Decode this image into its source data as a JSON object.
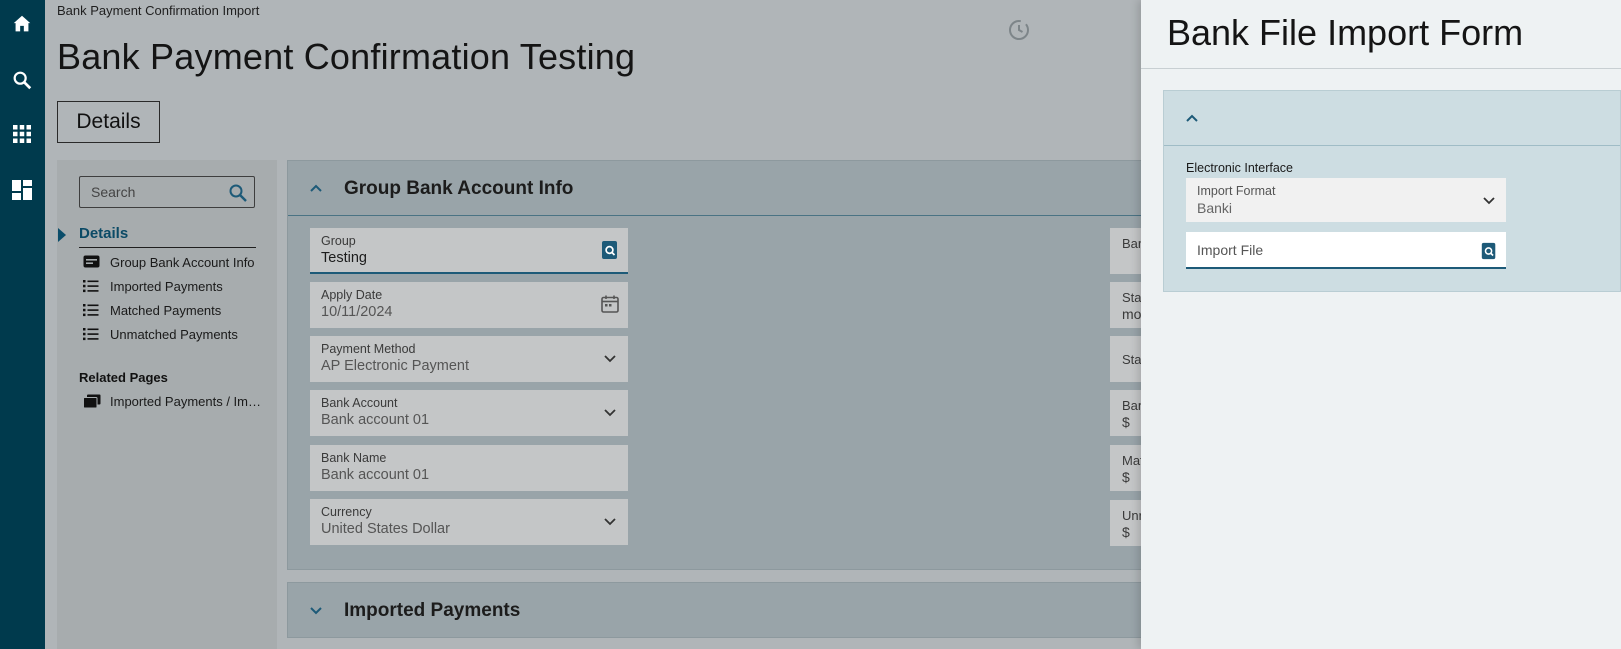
{
  "rail": {
    "items": [
      "home-icon",
      "search-icon",
      "apps-grid-icon",
      "dashboard-icon"
    ]
  },
  "header": {
    "breadcrumb": "Bank Payment Confirmation Import",
    "title": "Bank Payment Confirmation Testing",
    "tab_label": "Details"
  },
  "sidenav": {
    "search_placeholder": "Search",
    "details_label": "Details",
    "items": [
      {
        "label": "Group Bank Account Info",
        "icon": "card-icon"
      },
      {
        "label": "Imported Payments",
        "icon": "list-icon"
      },
      {
        "label": "Matched Payments",
        "icon": "list-icon"
      },
      {
        "label": "Unmatched Payments",
        "icon": "list-icon"
      }
    ],
    "related_title": "Related Pages",
    "related_items": [
      {
        "label": "Imported Payments / Im…",
        "icon": "pages-icon"
      }
    ]
  },
  "section": {
    "title": "Group Bank Account Info",
    "fields": [
      {
        "label": "Group",
        "value": "Testing"
      },
      {
        "label": "Apply Date",
        "value": "10/11/2024"
      },
      {
        "label": "Payment Method",
        "value": "AP Electronic Payment"
      },
      {
        "label": "Bank Account",
        "value": "Bank account 01"
      },
      {
        "label": "Bank Name",
        "value": "Bank account 01"
      },
      {
        "label": "Currency",
        "value": "United States Dollar"
      }
    ],
    "right_fields": [
      {
        "label": "Bar",
        "value": ""
      },
      {
        "label": "Stat",
        "value": "mo"
      },
      {
        "label": "Sta",
        "value": ""
      },
      {
        "label": "Ban",
        "value": "$"
      },
      {
        "label": "Mat",
        "value": "$"
      },
      {
        "label": "Unr",
        "value": "$"
      }
    ]
  },
  "section2": {
    "title": "Imported Payments"
  },
  "panel": {
    "title": "Bank File Import Form",
    "group_label": "Electronic Interface",
    "import_format": {
      "label": "Import Format",
      "value": "Banki"
    },
    "import_file": {
      "placeholder": "Import File"
    }
  },
  "colors": {
    "rail": "#003a4d",
    "accent": "#0b4a66",
    "panel_section": "#cddde2"
  }
}
